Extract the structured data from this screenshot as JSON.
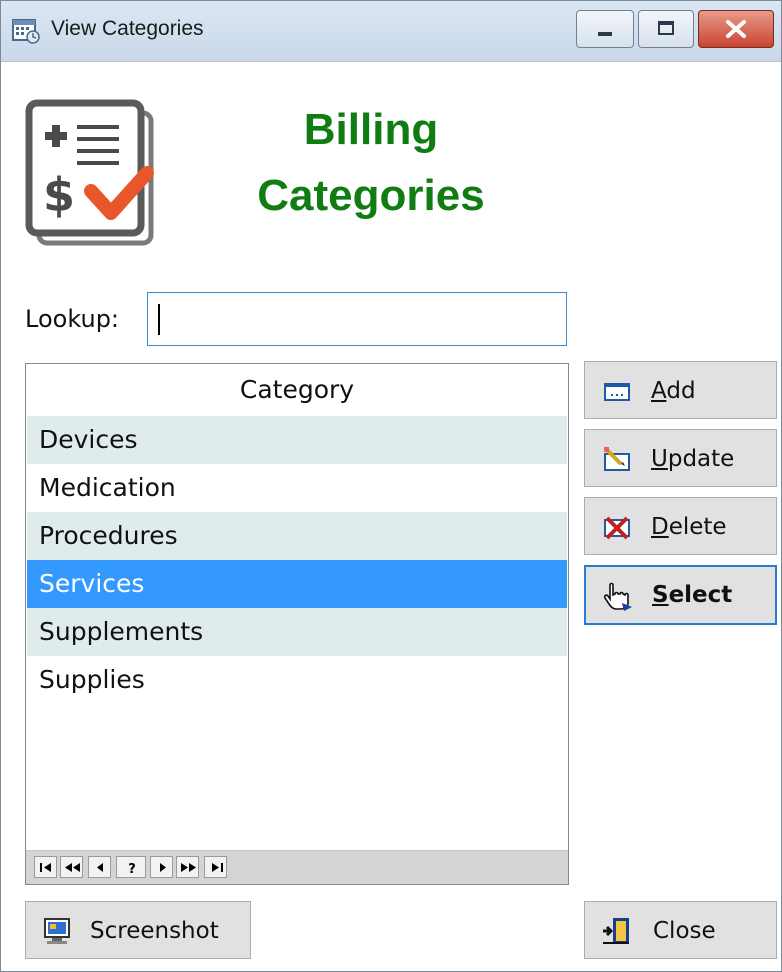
{
  "window": {
    "title": "View Categories"
  },
  "header": {
    "title_line1": "Billing",
    "title_line2": "Categories",
    "title_color": "#0f7d12",
    "logo_icon": "billing-list-icon"
  },
  "lookup": {
    "label": "Lookup:",
    "value": "",
    "placeholder": ""
  },
  "grid": {
    "column_header": "Category",
    "rows": [
      {
        "label": "Devices",
        "selected": false
      },
      {
        "label": "Medication",
        "selected": false
      },
      {
        "label": "Procedures",
        "selected": false
      },
      {
        "label": "Services",
        "selected": true
      },
      {
        "label": "Supplements",
        "selected": false
      },
      {
        "label": "Supplies",
        "selected": false
      }
    ],
    "row_alt_color": "#e0ecec",
    "selected_color": "#3399ff",
    "nav": {
      "first": "first-record-icon",
      "prev_page": "previous-page-icon",
      "prev": "previous-record-icon",
      "find": "?",
      "next": "next-record-icon",
      "next_page": "next-page-icon",
      "last": "last-record-icon"
    }
  },
  "actions": {
    "add": {
      "mnemonic": "A",
      "rest": "dd",
      "icon": "add-record-icon"
    },
    "update": {
      "mnemonic": "U",
      "rest": "pdate",
      "icon": "edit-record-icon"
    },
    "delete": {
      "mnemonic": "D",
      "rest": "elete",
      "icon": "delete-record-icon"
    },
    "select": {
      "mnemonic": "S",
      "rest": "elect",
      "icon": "hand-pointer-icon"
    }
  },
  "footer": {
    "screenshot_label": "Screenshot",
    "screenshot_icon": "monitor-icon",
    "close_label": "Close",
    "close_icon": "exit-door-icon"
  }
}
